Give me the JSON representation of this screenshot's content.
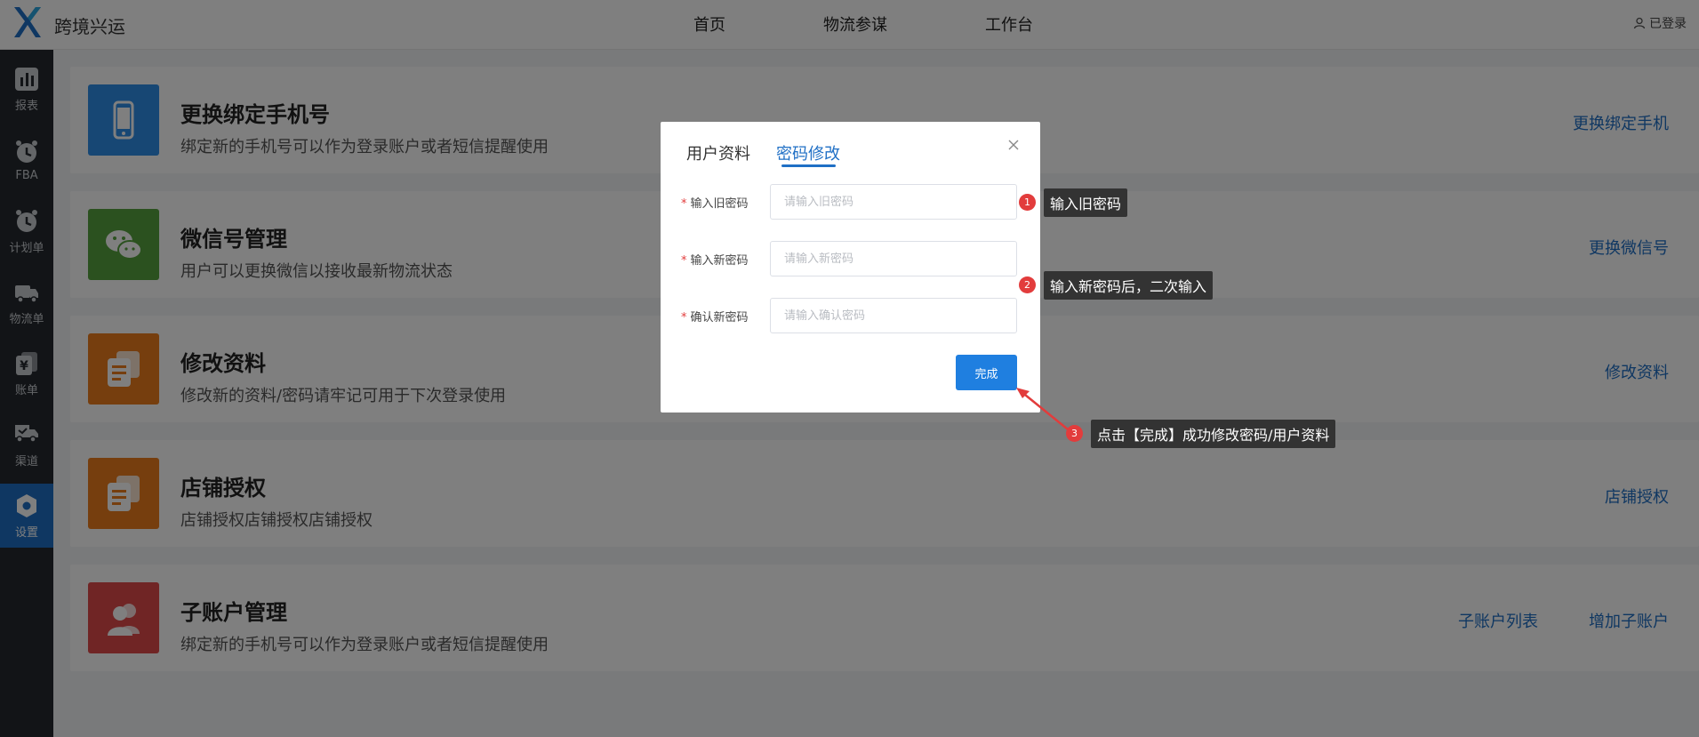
{
  "header": {
    "brand": "跨境兴运",
    "nav": [
      "首页",
      "物流参谋",
      "工作台"
    ],
    "user_status": "已登录"
  },
  "sidebar": {
    "items": [
      {
        "label": "报表",
        "icon": "bar-chart-icon"
      },
      {
        "label": "FBA",
        "icon": "alarm-clock-icon"
      },
      {
        "label": "计划单",
        "icon": "alarm-clock-icon"
      },
      {
        "label": "物流单",
        "icon": "truck-icon"
      },
      {
        "label": "账单",
        "icon": "bill-icon"
      },
      {
        "label": "渠道",
        "icon": "channel-truck-icon"
      },
      {
        "label": "设置",
        "icon": "settings-icon",
        "active": true
      }
    ]
  },
  "cards": [
    {
      "title": "更换绑定手机号",
      "desc": "绑定新的手机号可以作为登录账户或者短信提醒使用",
      "links": [
        "更换绑定手机"
      ],
      "color": "#2f8fe8",
      "icon": "phone-icon"
    },
    {
      "title": "微信号管理",
      "desc": "用户可以更换微信以接收最新物流状态",
      "links": [
        "更换微信号"
      ],
      "color": "#56a23e",
      "icon": "wechat-icon"
    },
    {
      "title": "修改资料",
      "desc": "修改新的资料/密码请牢记可用于下次登录使用",
      "links": [
        "修改资料"
      ],
      "color": "#ec7d1d",
      "icon": "documents-icon"
    },
    {
      "title": "店铺授权",
      "desc": "店铺授权店铺授权店铺授权",
      "links": [
        "店铺授权"
      ],
      "color": "#ec7d1d",
      "icon": "documents-icon"
    },
    {
      "title": "子账户管理",
      "desc": "绑定新的手机号可以作为登录账户或者短信提醒使用",
      "links": [
        "子账户列表",
        "增加子账户"
      ],
      "color": "#e04b4b",
      "icon": "users-icon"
    }
  ],
  "modal": {
    "tabs": [
      "用户资料",
      "密码修改"
    ],
    "active_tab": 1,
    "fields": [
      {
        "label": "输入旧密码",
        "placeholder": "请输入旧密码",
        "value": ""
      },
      {
        "label": "输入新密码",
        "placeholder": "请输入新密码",
        "value": ""
      },
      {
        "label": "确认新密码",
        "placeholder": "请输入确认密码",
        "value": ""
      }
    ],
    "required_mark": "*",
    "submit_label": "完成"
  },
  "annotations": [
    {
      "num": "1",
      "text": "输入旧密码"
    },
    {
      "num": "2",
      "text": "输入新密码后，二次输入"
    },
    {
      "num": "3",
      "text": "点击【完成】成功修改密码/用户资料"
    }
  ],
  "colors": {
    "accent": "#1f6fc5",
    "sidebar_bg": "#24292f",
    "annotation_badge": "#e23c3c",
    "annotation_tip_bg": "#333333"
  }
}
